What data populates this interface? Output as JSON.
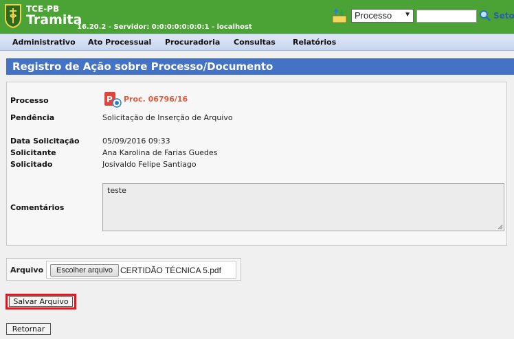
{
  "header": {
    "org": "TCE-PB",
    "app": "Tramita",
    "server_info": "16.20.2 - Servidor: 0:0:0:0:0:0:0:1 - localhost",
    "search_type": "Processo",
    "search_value": "",
    "setor_label": "Setor"
  },
  "menu": [
    {
      "label": "Administrativo"
    },
    {
      "label": "Ato Processual"
    },
    {
      "label": "Procuradoria"
    },
    {
      "label": "Consultas"
    },
    {
      "label": "Relatórios"
    }
  ],
  "page": {
    "title": "Registro de Ação sobre Processo/Documento"
  },
  "form": {
    "processo_label": "Processo",
    "processo_value": "Proc. 06796/16",
    "pendencia_label": "Pendência",
    "pendencia_value": "Solicitação de Inserção de Arquivo",
    "data_label": "Data Solicitação",
    "data_value": "05/09/2016 09:33",
    "solicitante_label": "Solicitante",
    "solicitante_value": "Ana Karolina de Farias Guedes",
    "solicitado_label": "Solicitado",
    "solicitado_value": "Josivaldo Felipe Santiago",
    "comentarios_label": "Comentários",
    "comentarios_value": "teste"
  },
  "file": {
    "label": "Arquivo",
    "choose_label": "Escolher arquivo",
    "file_name": "CERTIDÃO TÉCNICA 5.pdf"
  },
  "actions": {
    "save_label": "Salvar Arquivo",
    "back_label": "Retornar"
  },
  "colors": {
    "header_green": "#4aa334",
    "title_blue": "#4472c4",
    "link_red": "#e05a3c",
    "highlight_red": "#e8141c"
  }
}
